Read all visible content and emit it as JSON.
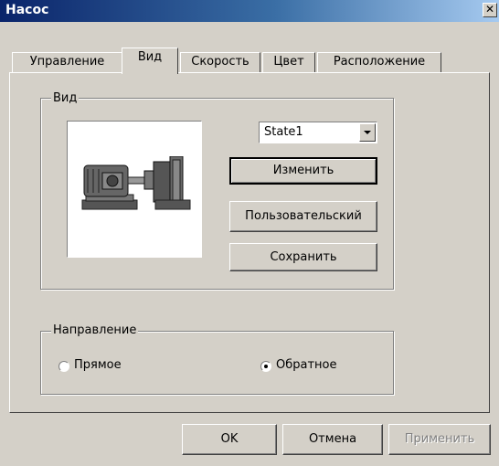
{
  "window": {
    "title": "Насос",
    "close_glyph": "✕"
  },
  "tabs": [
    {
      "label": "Управление",
      "active": false
    },
    {
      "label": "Вид",
      "active": true
    },
    {
      "label": "Скорость",
      "active": false
    },
    {
      "label": "Цвет",
      "active": false
    },
    {
      "label": "Расположение",
      "active": false
    }
  ],
  "view_group": {
    "label": "Вид",
    "state_select": {
      "value": "State1"
    },
    "buttons": {
      "change": "Изменить",
      "custom": "Пользовательский",
      "save": "Сохранить"
    },
    "preview_icon": "pump-motor-icon"
  },
  "direction_group": {
    "label": "Направление",
    "options": [
      {
        "label": "Прямое",
        "checked": false
      },
      {
        "label": "Обратное",
        "checked": true
      }
    ]
  },
  "footer": {
    "ok": "OK",
    "cancel": "Отмена",
    "apply": "Применить",
    "apply_disabled": true
  }
}
